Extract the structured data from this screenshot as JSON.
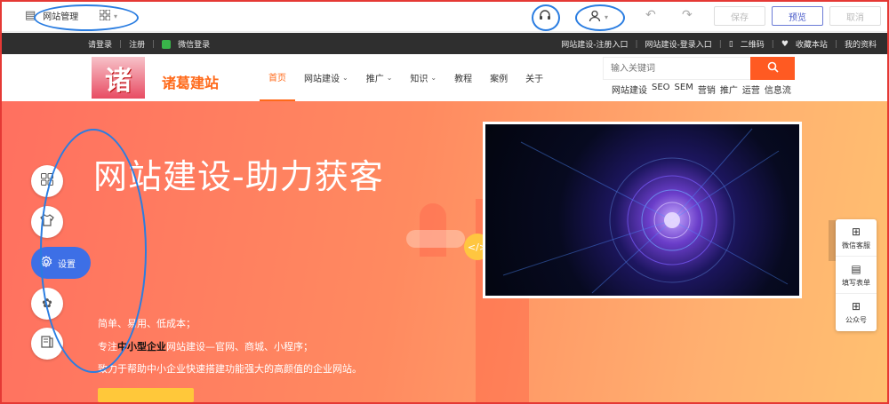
{
  "editor": {
    "title": "网站管理",
    "save": "保存",
    "preview": "预览",
    "cancel": "取消"
  },
  "topbar": {
    "login": "请登录",
    "register": "注册",
    "wechat_login": "微信登录",
    "right_links": [
      "网站建设-注册入口",
      "网站建设-登录入口",
      "二维码",
      "收藏本站",
      "我的资料"
    ]
  },
  "site": {
    "logo_char": "诸",
    "name": "诸葛建站"
  },
  "nav": {
    "items": [
      {
        "label": "首页",
        "dropdown": false,
        "active": true
      },
      {
        "label": "网站建设",
        "dropdown": true,
        "active": false
      },
      {
        "label": "推广",
        "dropdown": true,
        "active": false
      },
      {
        "label": "知识",
        "dropdown": true,
        "active": false
      },
      {
        "label": "教程",
        "dropdown": false,
        "active": false
      },
      {
        "label": "案例",
        "dropdown": false,
        "active": false
      },
      {
        "label": "关于",
        "dropdown": false,
        "active": false
      }
    ]
  },
  "search": {
    "placeholder": "输入关键词",
    "hot_tags": [
      "网站建设",
      "SEO",
      "SEM",
      "营销",
      "推广",
      "运营",
      "信息流"
    ]
  },
  "hero": {
    "title": "网站建设-助力获客",
    "line1": "简单、易用、低成本；",
    "line2_prefix": "专注",
    "line2_bold": "中小型企业",
    "line2_suffix": "网站建设—官网、商城、小程序；",
    "line3": "致力于帮助中小企业快速搭建功能强大的高颜值的企业网站。"
  },
  "float_panel": [
    "微信客服",
    "填写表单",
    "公众号"
  ],
  "tools": {
    "active_label": "设置"
  },
  "colors": {
    "accent": "#ff6a1a",
    "primary_blue": "#3d6fe6",
    "frame_red": "#e53935",
    "annotation_blue": "#2a7de1"
  }
}
